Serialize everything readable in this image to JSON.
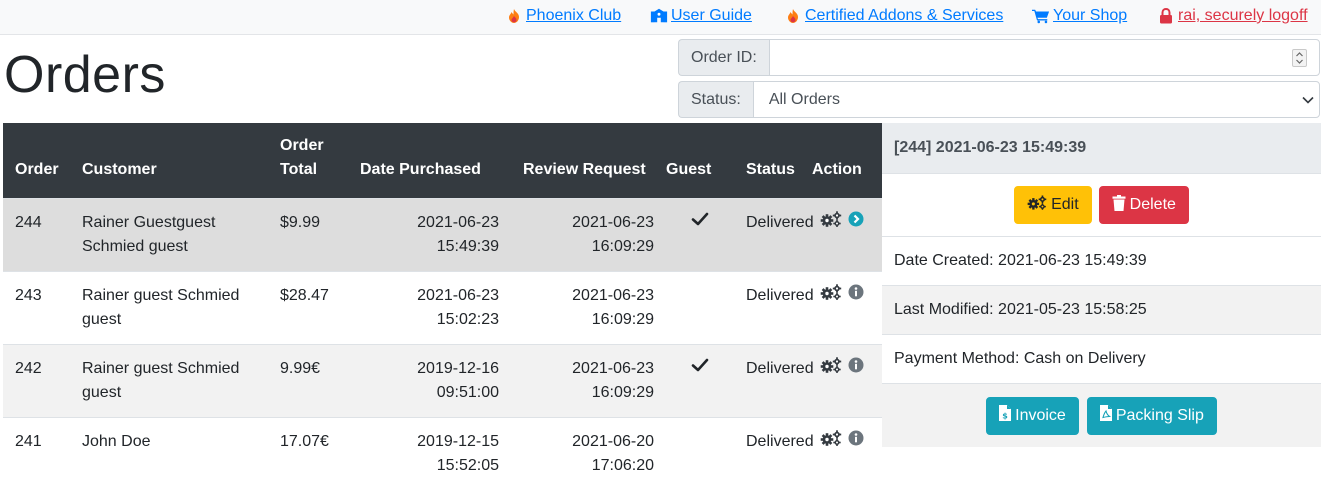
{
  "topnav": {
    "club": "Phoenix Club",
    "guide": "User Guide",
    "addons": "Certified Addons & Services",
    "shop": "Your Shop",
    "logoff": "rai, securely logoff"
  },
  "page": {
    "title": "Orders"
  },
  "filters": {
    "order_id_label": "Order ID:",
    "order_id_value": "",
    "status_label": "Status:",
    "status_value": "All Orders"
  },
  "table": {
    "headers": {
      "order": "Order",
      "customer": "Customer",
      "total_line1": "Order",
      "total_line2": "Total",
      "date": "Date Purchased",
      "review": "Review Request",
      "guest": "Guest",
      "status": "Status",
      "action": "Action"
    },
    "rows": [
      {
        "order": "244",
        "customer": "Rainer Guestguest Schmied guest",
        "total": "$9.99",
        "date": "2021-06-23 15:49:39",
        "review": "2021-06-23 16:09:29",
        "guest": "✔",
        "status": "Delivered"
      },
      {
        "order": "243",
        "customer": "Rainer guest Schmied guest",
        "total": "$28.47",
        "date": "2021-06-23 15:02:23",
        "review": "2021-06-23 16:09:29",
        "guest": "",
        "status": "Delivered"
      },
      {
        "order": "242",
        "customer": "Rainer guest Schmied guest",
        "total": "9.99€",
        "date": "2019-12-16 09:51:00",
        "review": "2021-06-23 16:09:29",
        "guest": "✔",
        "status": "Delivered"
      },
      {
        "order": "241",
        "customer": "John Doe",
        "total": "17.07€",
        "date": "2019-12-15 15:52:05",
        "review": "2021-06-20 17:06:20",
        "guest": "",
        "status": "Delivered"
      }
    ]
  },
  "side": {
    "title": "[244] 2021-06-23 15:49:39",
    "edit": "Edit",
    "delete": "Delete",
    "date_created": "Date Created: 2021-06-23 15:49:39",
    "last_modified": "Last Modified: 2021-05-23 15:58:25",
    "payment": "Payment Method: Cash on Delivery",
    "invoice": "Invoice",
    "packing_slip": "Packing Slip"
  },
  "colors": {
    "link": "#007bff",
    "danger": "#dc3545",
    "warning": "#ffc107",
    "info": "#17a2b8",
    "table_header": "#343a40",
    "phoenix": "#fd7e14"
  },
  "icons": [
    "phoenix-icon",
    "user-guide-icon",
    "cart-icon",
    "lock-icon",
    "gears-icon",
    "chevron-circle-right-icon",
    "info-circle-icon",
    "trash-icon",
    "invoice-icon",
    "packing-slip-icon",
    "check-icon"
  ]
}
